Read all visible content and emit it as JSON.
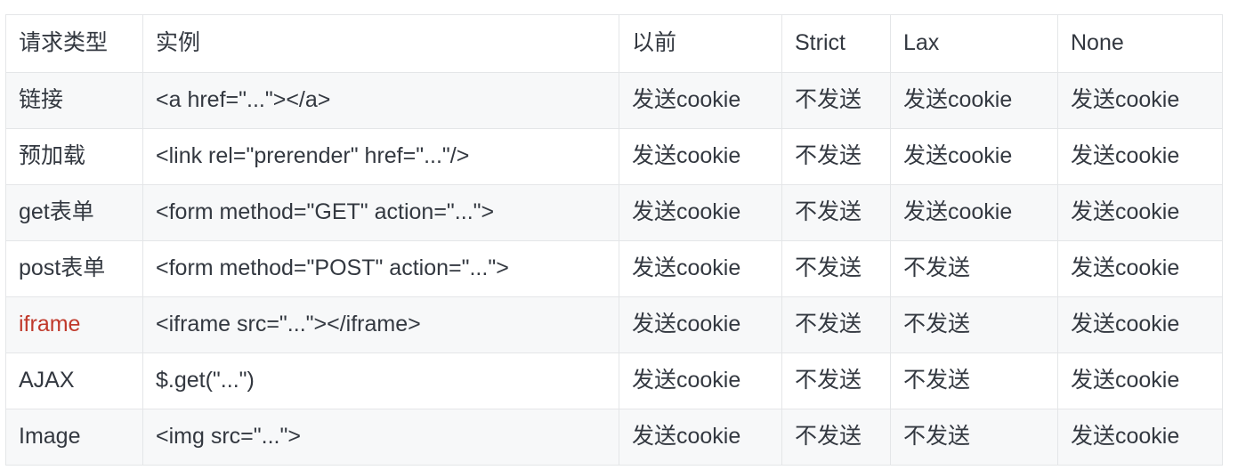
{
  "table": {
    "columns": [
      {
        "key": "type",
        "label": "请求类型"
      },
      {
        "key": "example",
        "label": "实例"
      },
      {
        "key": "before",
        "label": "以前"
      },
      {
        "key": "strict",
        "label": "Strict"
      },
      {
        "key": "lax",
        "label": "Lax"
      },
      {
        "key": "none",
        "label": "None"
      }
    ],
    "accent_color": "#c0392b",
    "border_color": "#e4e6e8",
    "stripe_color": "#f7f8f9",
    "text_color": "#333840",
    "rows": [
      {
        "type": "链接",
        "example": "<a href=\"...\"></a>",
        "before": "发送cookie",
        "strict": "不发送",
        "lax": "发送cookie",
        "none": "发送cookie",
        "highlight": false
      },
      {
        "type": "预加载",
        "example": "<link rel=\"prerender\" href=\"...\"/>",
        "before": "发送cookie",
        "strict": "不发送",
        "lax": "发送cookie",
        "none": "发送cookie",
        "highlight": false
      },
      {
        "type": "get表单",
        "example": "<form method=\"GET\" action=\"...\">",
        "before": "发送cookie",
        "strict": "不发送",
        "lax": "发送cookie",
        "none": "发送cookie",
        "highlight": false
      },
      {
        "type": "post表单",
        "example": "<form method=\"POST\" action=\"...\">",
        "before": "发送cookie",
        "strict": "不发送",
        "lax": "不发送",
        "none": "发送cookie",
        "highlight": false
      },
      {
        "type": "iframe",
        "example": "<iframe src=\"...\"></iframe>",
        "before": "发送cookie",
        "strict": "不发送",
        "lax": "不发送",
        "none": "发送cookie",
        "highlight": true
      },
      {
        "type": "AJAX",
        "example": "$.get(\"...\")",
        "before": "发送cookie",
        "strict": "不发送",
        "lax": "不发送",
        "none": "发送cookie",
        "highlight": false
      },
      {
        "type": "Image",
        "example": "<img src=\"...\">",
        "before": "发送cookie",
        "strict": "不发送",
        "lax": "不发送",
        "none": "发送cookie",
        "highlight": false
      }
    ]
  }
}
